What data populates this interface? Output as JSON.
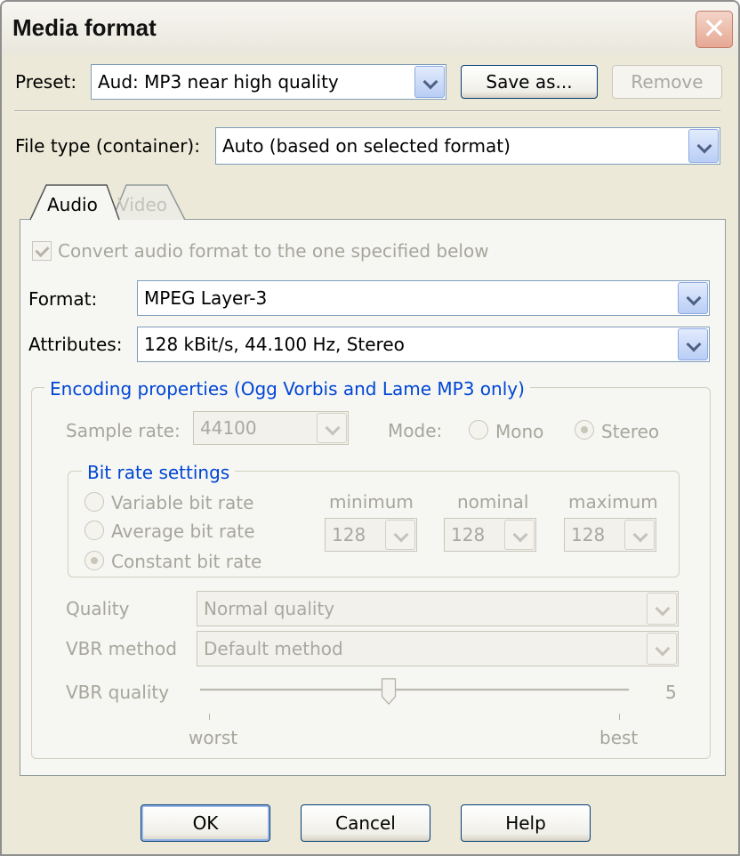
{
  "window": {
    "title": "Media format",
    "close_glyph": "✕"
  },
  "preset": {
    "label": "Preset:",
    "value": "Aud: MP3 near high quality",
    "save_as_label": "Save as...",
    "remove_label": "Remove"
  },
  "file_type": {
    "label": "File type (container):",
    "value": "Auto (based on selected format)"
  },
  "tabs": [
    {
      "label": "Audio",
      "selected": true
    },
    {
      "label": "Video",
      "selected": false
    }
  ],
  "audio": {
    "convert_label": "Convert audio format to the one specified below",
    "convert_checked": true,
    "format_label": "Format:",
    "format_value": "MPEG Layer-3",
    "attributes_label": "Attributes:",
    "attributes_value": "128 kBit/s, 44.100 Hz, Stereo"
  },
  "encoding": {
    "legend": "Encoding properties (Ogg Vorbis and Lame MP3 only)",
    "sample_rate_label": "Sample rate:",
    "sample_rate_value": "44100",
    "mode_label": "Mode:",
    "mode_options": [
      "Mono",
      "Stereo"
    ],
    "mode_selected": "Stereo",
    "bitrate": {
      "legend": "Bit rate settings",
      "options": [
        "Variable bit rate",
        "Average bit rate",
        "Constant bit rate"
      ],
      "selected": "Constant bit rate",
      "minimum_label": "minimum",
      "nominal_label": "nominal",
      "maximum_label": "maximum",
      "minimum_value": "128",
      "nominal_value": "128",
      "maximum_value": "128"
    },
    "quality_label": "Quality",
    "quality_value": "Normal quality",
    "vbr_method_label": "VBR method",
    "vbr_method_value": "Default method",
    "vbr_quality_label": "VBR quality",
    "vbr_quality_value": "5",
    "vbr_quality_fraction": 0.44,
    "slider_min_label": "worst",
    "slider_max_label": "best"
  },
  "buttons": {
    "ok": "OK",
    "cancel": "Cancel",
    "help": "Help"
  },
  "colors": {
    "dialog_bg": "#ece9d8",
    "legend_text": "#0046d5",
    "button_border": "#003c74",
    "disabled_text": "#a7a69c"
  }
}
